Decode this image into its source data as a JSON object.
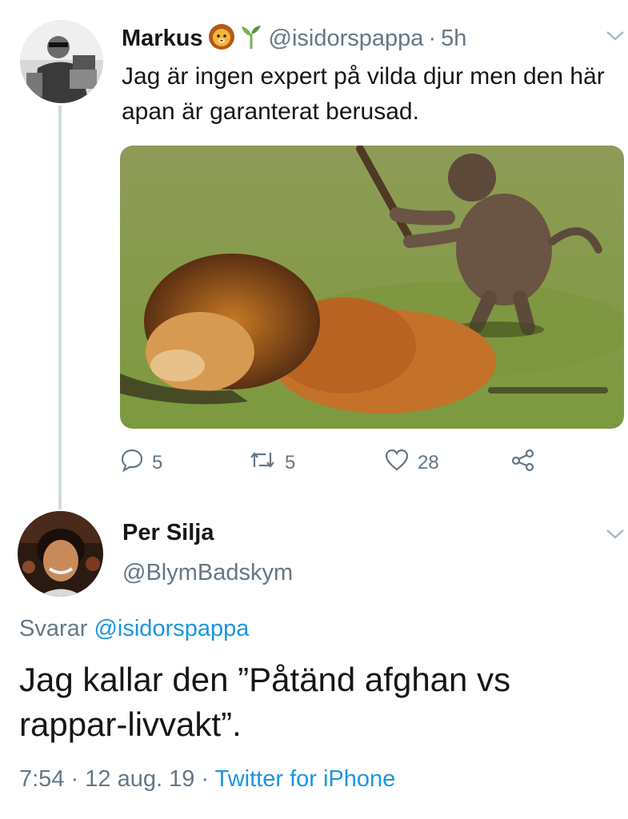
{
  "tweet1": {
    "display_name": "Markus",
    "handle": "@isidorspappa",
    "separator": "·",
    "time": "5h",
    "text": "Jag är ingen expert på vilda djur men den här apan är garanterat berusad.",
    "emojis": [
      "lion-face-icon",
      "seedling-icon"
    ],
    "actions": {
      "replies": "5",
      "retweets": "5",
      "likes": "28"
    }
  },
  "tweet2": {
    "display_name": "Per Silja",
    "handle": "@BlymBadskym",
    "replying_prefix": "Svarar",
    "replying_to": "@isidorspappa",
    "text": "Jag kallar den ”Påtänd afghan vs rappar-livvakt”.",
    "meta_time": "7:54",
    "meta_sep1": "·",
    "meta_date": "12 aug. 19",
    "meta_sep2": "·",
    "meta_source": "Twitter for iPhone"
  },
  "colors": {
    "text": "#14171a",
    "secondary": "#657786",
    "link": "#1b95e0",
    "thread_line": "#cfd9de"
  }
}
